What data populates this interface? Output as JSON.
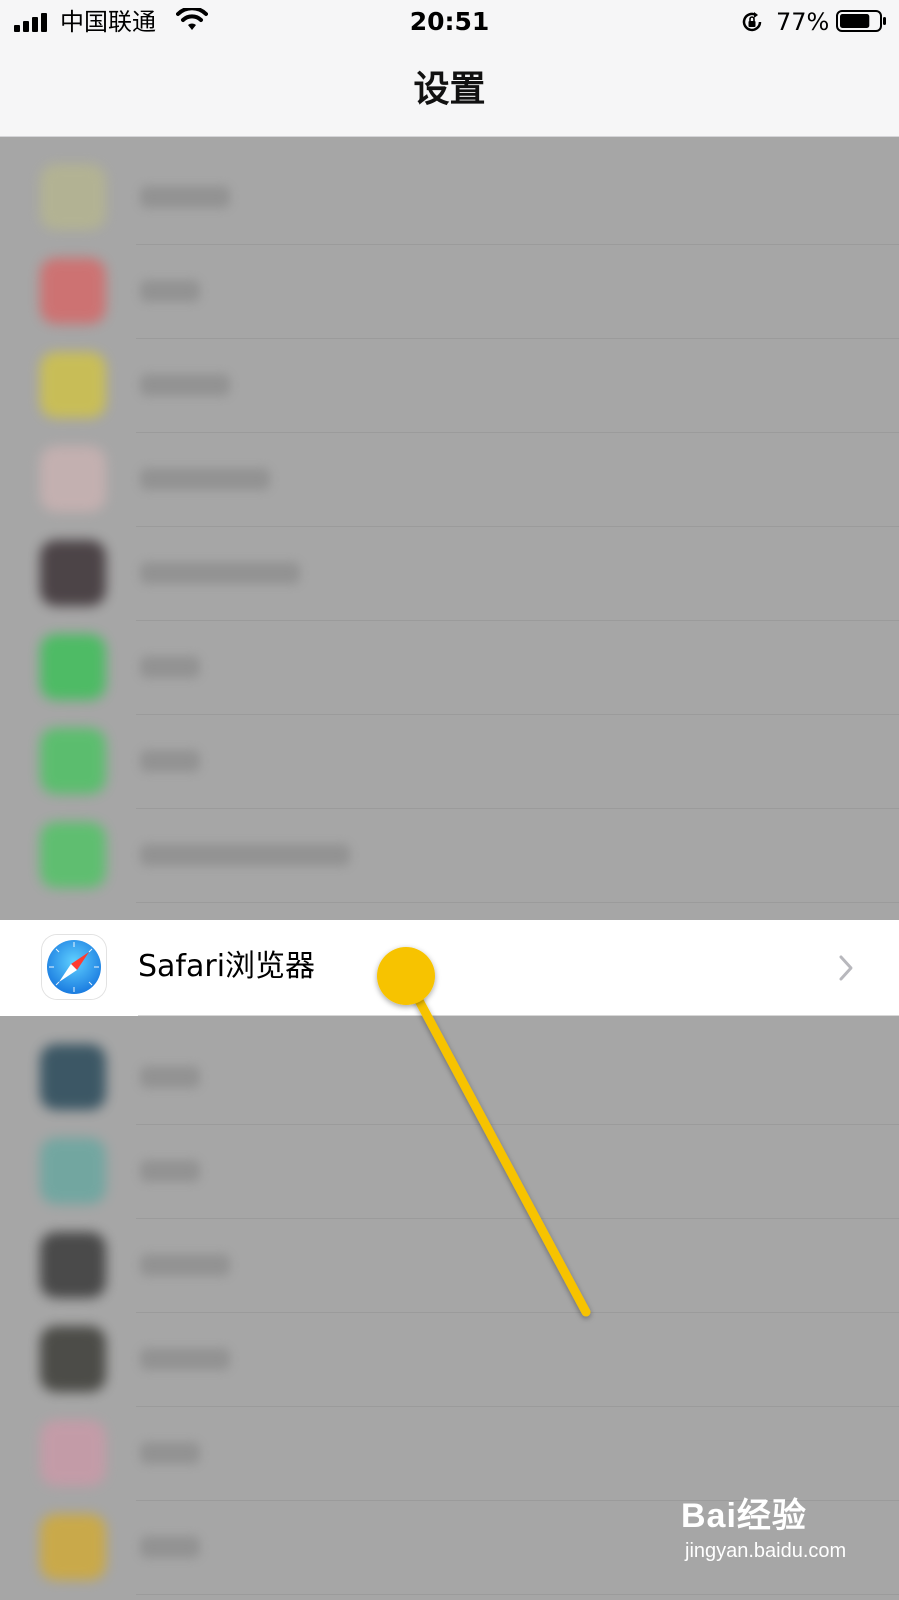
{
  "status_bar": {
    "carrier": "中国联通",
    "time": "20:51",
    "battery_percent": "77%",
    "battery_level": 0.77,
    "icons": [
      "signal-icon",
      "wifi-icon",
      "orientation-lock-icon",
      "battery-icon"
    ]
  },
  "nav": {
    "title": "设置"
  },
  "blurred_rows": {
    "icon_colors": [
      "#b5b590",
      "#d46a6a",
      "#cfc24a",
      "#c9b2b2",
      "#3d3337",
      "#3fbf5a",
      "#4fc265",
      "#53c367",
      "#2a4a5a",
      "#6aa7a0",
      "#3a3a3a",
      "#3d3d38",
      "#c99aa8",
      "#d0aa3a"
    ]
  },
  "highlight_row": {
    "label": "Safari浏览器",
    "icon": "safari-compass-icon",
    "chevron": "chevron-right-icon"
  },
  "annotation": {
    "pointer_color": "#f7c300"
  },
  "watermark": {
    "brand": "Bai经验",
    "url": "jingyan.baidu.com"
  }
}
